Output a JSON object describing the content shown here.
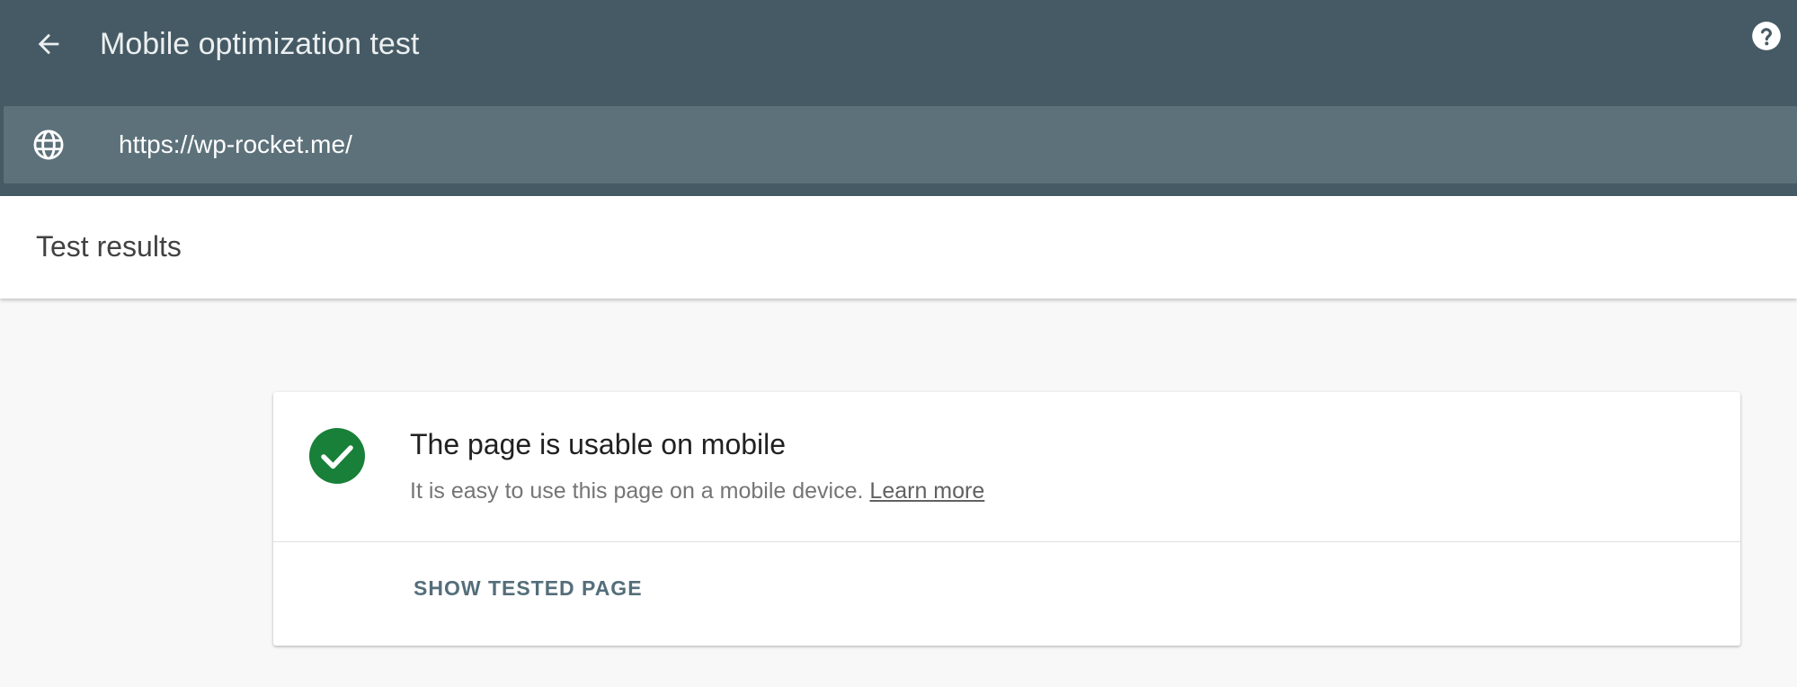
{
  "header": {
    "title": "Mobile optimization test",
    "back_icon": "arrow-left-icon",
    "help_icon": "help-circle-icon",
    "background_color": "#455a64"
  },
  "url_bar": {
    "icon": "globe-icon",
    "value": "https://wp-rocket.me/",
    "background_color": "#5d717a"
  },
  "results": {
    "title": "Test results"
  },
  "verdict_card": {
    "status_icon": "check-circle-icon",
    "status_color": "#188038",
    "heading": "The page is usable on mobile",
    "description": "It is easy to use this page on a mobile device.",
    "learn_more_label": "Learn more",
    "show_tested_page_label": "SHOW TESTED PAGE"
  }
}
